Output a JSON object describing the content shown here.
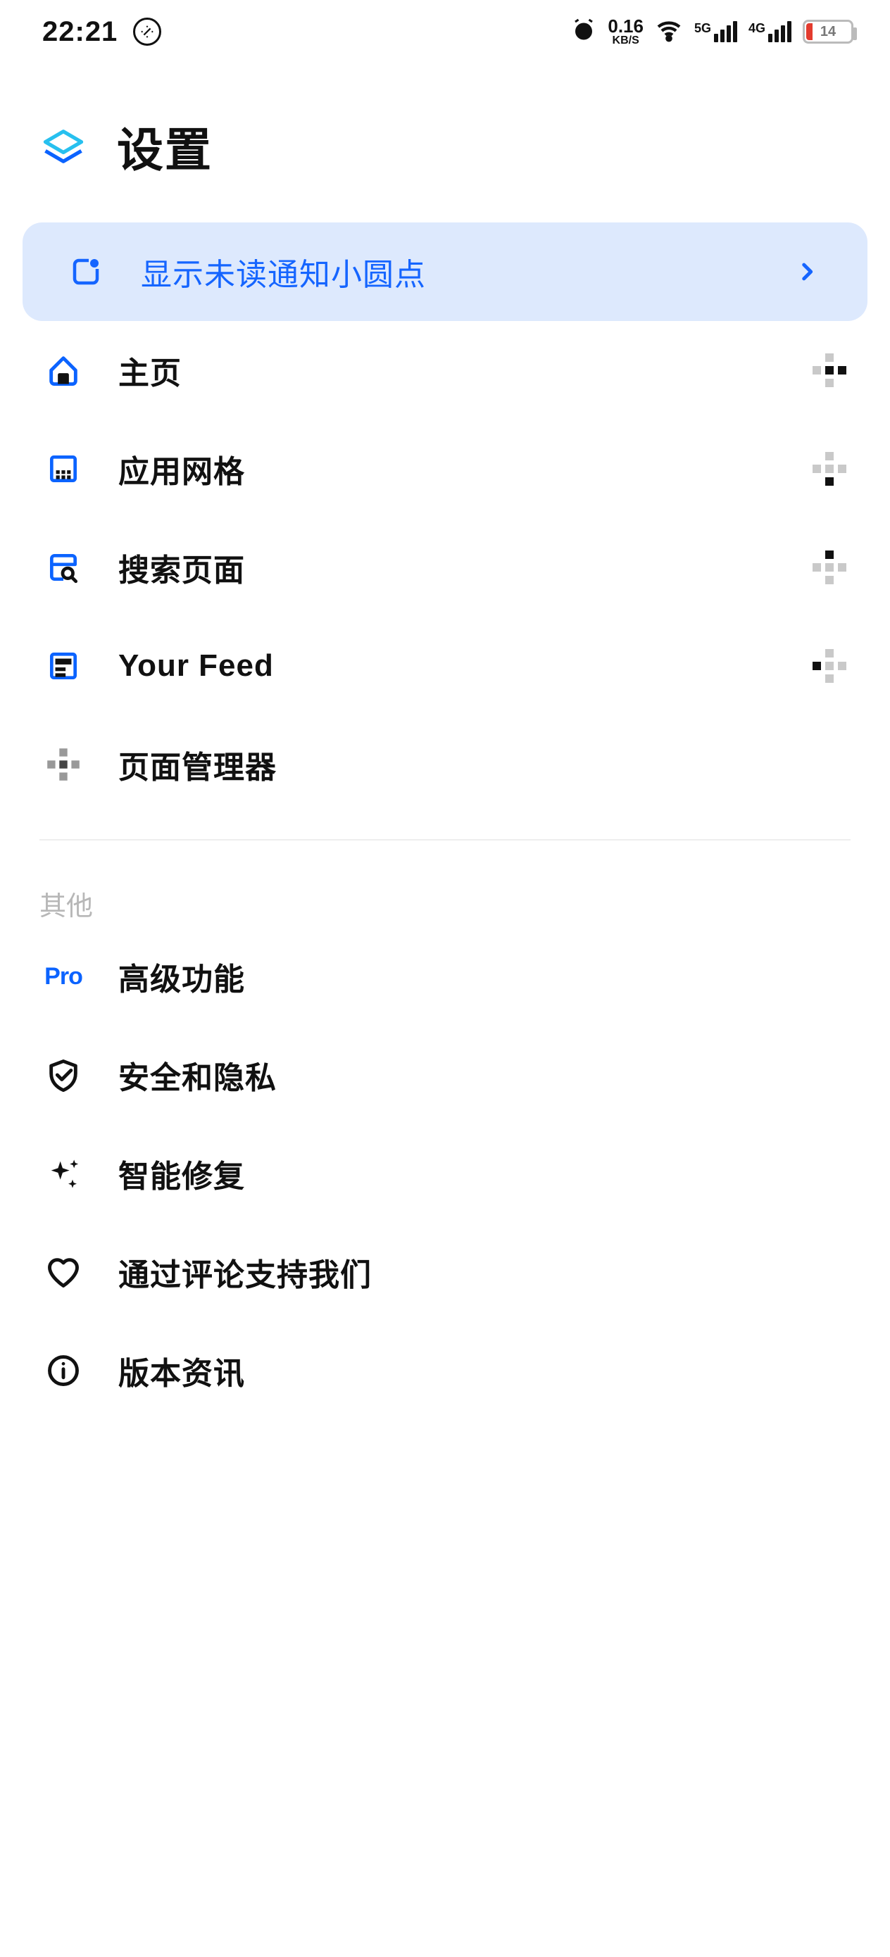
{
  "status": {
    "time": "22:21",
    "speed_value": "0.16",
    "speed_unit": "KB/S",
    "net1_label": "5G",
    "net2_label": "4G",
    "battery_pct": "14"
  },
  "header": {
    "title": "设置"
  },
  "banner": {
    "label": "显示未读通知小圆点"
  },
  "sections": {
    "pages": [
      {
        "icon": "home",
        "label": "主页",
        "dots_dark": ""
      },
      {
        "icon": "grid",
        "label": "应用网格",
        "dots_dark": ""
      },
      {
        "icon": "search",
        "label": "搜索页面",
        "dots_dark": ""
      },
      {
        "icon": "feed",
        "label": "Your Feed",
        "dots_dark": ""
      },
      {
        "icon": "manager",
        "label": "页面管理器"
      }
    ],
    "other_header": "其他",
    "other": [
      {
        "icon": "pro",
        "label": "高级功能"
      },
      {
        "icon": "shield",
        "label": "安全和隐私"
      },
      {
        "icon": "sparkle",
        "label": "智能修复"
      },
      {
        "icon": "heart",
        "label": "通过评论支持我们"
      },
      {
        "icon": "info",
        "label": "版本资讯"
      }
    ]
  }
}
